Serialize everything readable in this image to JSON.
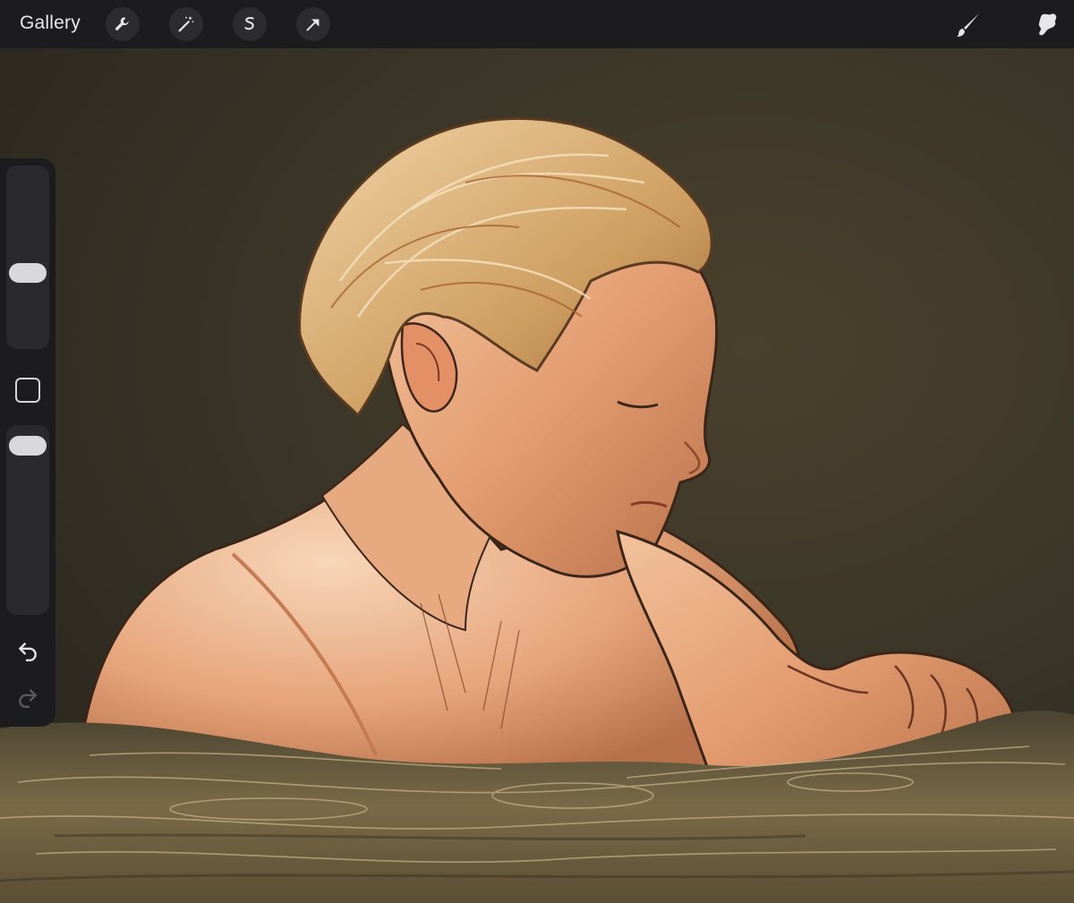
{
  "toolbar": {
    "gallery_label": "Gallery",
    "tools": [
      {
        "name": "wrench-icon"
      },
      {
        "name": "magic-wand-icon"
      },
      {
        "name": "selection-icon"
      },
      {
        "name": "transform-arrow-icon"
      }
    ],
    "right_tools": [
      {
        "name": "brush-icon"
      },
      {
        "name": "smudge-icon"
      }
    ]
  },
  "sidebar": {
    "brush_size_level": 0.4,
    "opacity_level": 0.95
  },
  "colors": {
    "toolbar_bg": "#1c1c1e",
    "canvas_bg": "#3e3829",
    "skin": "#e8a57c",
    "hair": "#d9b27c",
    "water": "#6a5c3c"
  }
}
